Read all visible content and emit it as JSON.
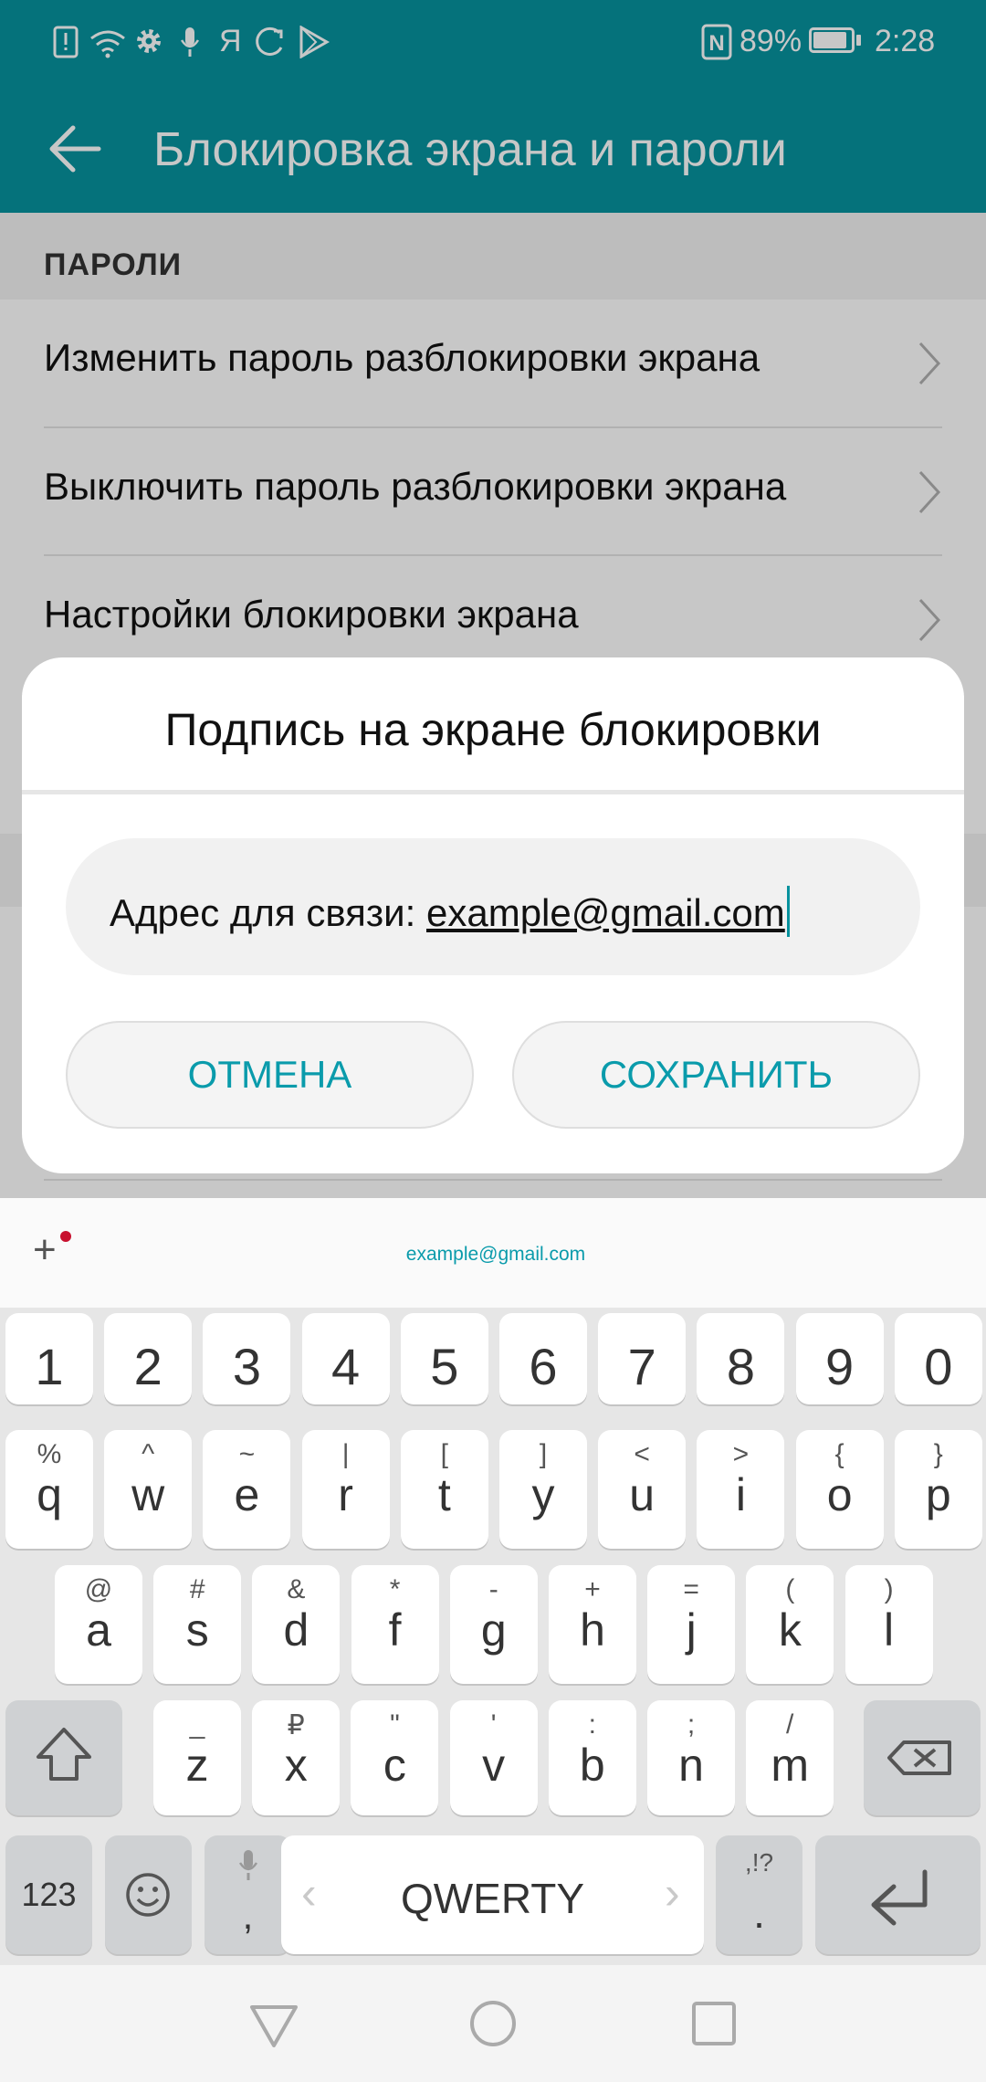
{
  "status_bar": {
    "left_icons": [
      "alert-file-icon",
      "wifi-icon",
      "gear-icon",
      "mic-icon",
      "yandex-icon",
      "sync-icon",
      "play-store-icon"
    ],
    "yandex_glyph": "Я",
    "nfc_glyph": "N",
    "battery_percent": "89%",
    "battery_level": 0.89,
    "time": "2:28"
  },
  "app_bar": {
    "title": "Блокировка экрана и пароли",
    "back_icon": "back-arrow-icon"
  },
  "settings": {
    "section_title": "ПАРОЛИ",
    "rows": [
      {
        "label": "Изменить пароль разблокировки экрана"
      },
      {
        "label": "Выключить пароль разблокировки экрана"
      },
      {
        "label": "Настройки блокировки экрана"
      }
    ]
  },
  "dialog": {
    "title": "Подпись на экране блокировки",
    "field_prefix": "Адрес для связи: ",
    "field_link": "example@gmail.com",
    "cancel_label": "ОТМЕНА",
    "save_label": "СОХРАНИТЬ",
    "accent": "#0a9bab"
  },
  "keyboard": {
    "suggestion_plus": "+",
    "suggestion": "example@gmail.com",
    "numbers": [
      "1",
      "2",
      "3",
      "4",
      "5",
      "6",
      "7",
      "8",
      "9",
      "0"
    ],
    "row1": [
      {
        "main": "q",
        "sup": "%"
      },
      {
        "main": "w",
        "sup": "^"
      },
      {
        "main": "e",
        "sup": "~"
      },
      {
        "main": "r",
        "sup": "|"
      },
      {
        "main": "t",
        "sup": "["
      },
      {
        "main": "y",
        "sup": "]"
      },
      {
        "main": "u",
        "sup": "<"
      },
      {
        "main": "i",
        "sup": ">"
      },
      {
        "main": "o",
        "sup": "{"
      },
      {
        "main": "p",
        "sup": "}"
      }
    ],
    "row2": [
      {
        "main": "a",
        "sup": "@"
      },
      {
        "main": "s",
        "sup": "#"
      },
      {
        "main": "d",
        "sup": "&"
      },
      {
        "main": "f",
        "sup": "*"
      },
      {
        "main": "g",
        "sup": "-"
      },
      {
        "main": "h",
        "sup": "+"
      },
      {
        "main": "j",
        "sup": "="
      },
      {
        "main": "k",
        "sup": "("
      },
      {
        "main": "l",
        "sup": ")"
      }
    ],
    "row3": [
      {
        "main": "z",
        "sup": "_"
      },
      {
        "main": "x",
        "sup": "₽"
      },
      {
        "main": "c",
        "sup": "\""
      },
      {
        "main": "v",
        "sup": "'"
      },
      {
        "main": "b",
        "sup": ":"
      },
      {
        "main": "n",
        "sup": ";"
      },
      {
        "main": "m",
        "sup": "/"
      }
    ],
    "mode_label": "123",
    "comma": ",",
    "space_label": "QWERTY",
    "period": ".",
    "period_sup": ",!?",
    "space_left": "‹",
    "space_right": "›"
  },
  "nav_bar": {
    "icons": [
      "back-triangle-icon",
      "home-circle-icon",
      "recents-square-icon"
    ]
  }
}
